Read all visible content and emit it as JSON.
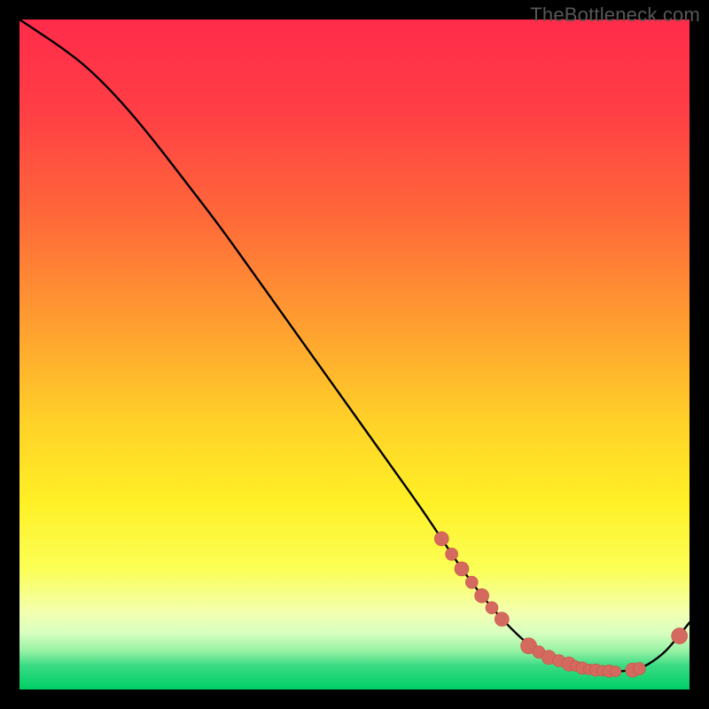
{
  "watermark": "TheBottleneck.com",
  "colors": {
    "gradient_top": "#ff2b4a",
    "gradient_mid1": "#ff8a2a",
    "gradient_mid2": "#ffe427",
    "gradient_low1": "#f8ff7a",
    "gradient_green": "#00d66b",
    "curve": "#000000",
    "marker_fill": "#d46a5f",
    "marker_stroke": "#c94f43"
  },
  "chart_data": {
    "type": "line",
    "title": "",
    "xlabel": "",
    "ylabel": "",
    "xlim": [
      0,
      100
    ],
    "ylim": [
      0,
      100
    ],
    "x": [
      0,
      3,
      6,
      10,
      15,
      20,
      25,
      30,
      35,
      40,
      45,
      50,
      55,
      60,
      63,
      66,
      69,
      72,
      75,
      77,
      79,
      81,
      83,
      85,
      87,
      89,
      91,
      93,
      96,
      98,
      100
    ],
    "y": [
      100,
      98,
      96,
      93,
      88,
      82,
      75.5,
      69,
      62,
      55,
      48,
      41,
      34,
      27,
      22.5,
      18,
      14,
      10.5,
      7.5,
      6,
      4.8,
      4,
      3.4,
      3,
      2.8,
      2.7,
      2.8,
      3.2,
      5.2,
      7.5,
      10
    ],
    "markers": {
      "x": [
        63.0,
        64.5,
        66.0,
        67.5,
        69.0,
        70.5,
        72.0,
        76.0,
        77.5,
        79.0,
        80.5,
        82.0,
        83.0,
        84.0,
        85.0,
        86.0,
        87.0,
        88.0,
        89.0,
        91.5,
        92.5,
        98.5
      ],
      "y": [
        22.5,
        20.2,
        18.0,
        16.0,
        14.0,
        12.2,
        10.5,
        6.5,
        5.6,
        4.8,
        4.3,
        3.8,
        3.5,
        3.2,
        3.0,
        2.9,
        2.8,
        2.75,
        2.7,
        2.9,
        3.1,
        8.0
      ],
      "r": [
        8,
        7,
        8,
        7,
        8,
        7,
        8,
        9,
        7,
        8,
        7,
        8,
        6,
        7,
        6,
        7,
        6,
        7,
        6,
        8,
        7,
        9
      ]
    }
  }
}
